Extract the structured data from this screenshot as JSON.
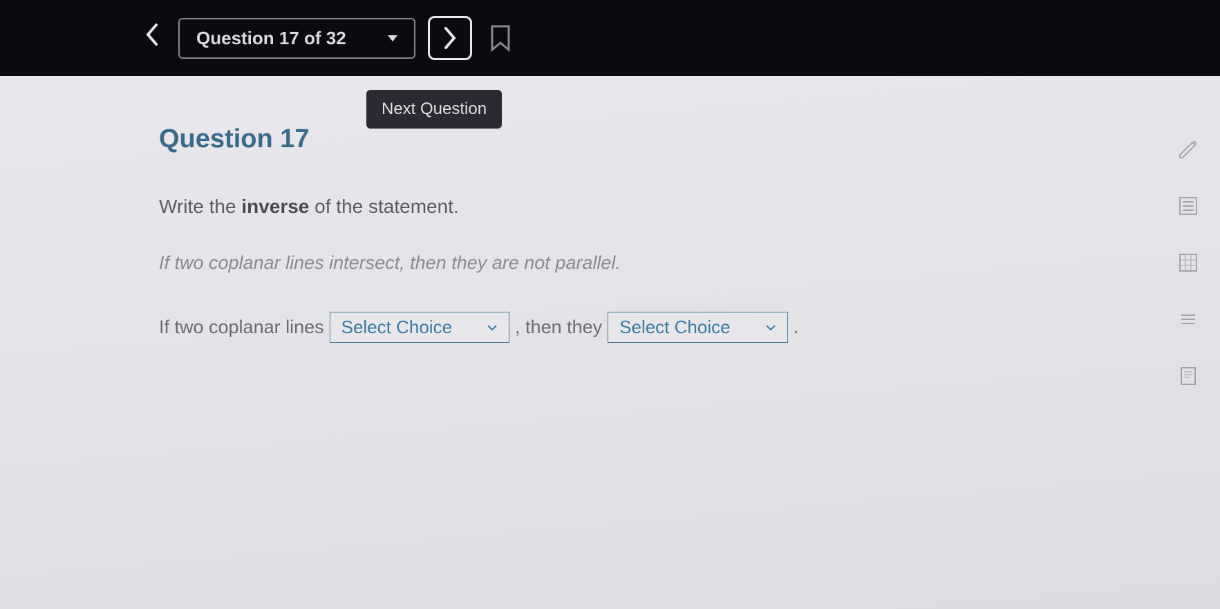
{
  "nav": {
    "question_selector_label": "Question 17 of 32",
    "tooltip_text": "Next Question"
  },
  "question": {
    "title": "Question 17",
    "instruction_prefix": "Write the ",
    "instruction_bold": "inverse",
    "instruction_suffix": " of the statement.",
    "given_statement": "If two coplanar lines intersect, then they are not parallel.",
    "answer_prefix": "If two coplanar lines",
    "answer_middle": ", then they",
    "answer_suffix": ".",
    "select_placeholder_1": "Select Choice",
    "select_placeholder_2": "Select Choice"
  }
}
